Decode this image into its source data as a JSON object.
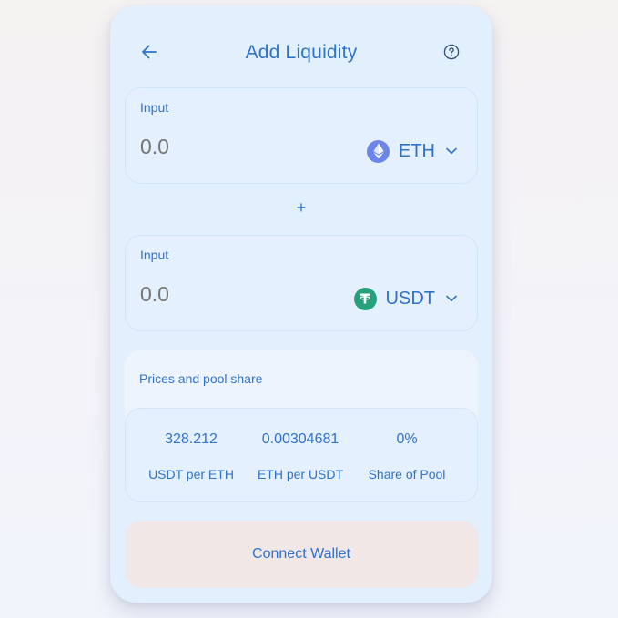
{
  "header": {
    "title": "Add Liquidity",
    "back_icon": "arrow-left-icon",
    "help_icon": "question-circle-icon"
  },
  "input_a": {
    "label": "Input",
    "placeholder": "0.0",
    "token": "ETH",
    "token_icon": "ethereum-icon"
  },
  "plus": "+",
  "input_b": {
    "label": "Input",
    "placeholder": "0.0",
    "token": "USDT",
    "token_icon": "tether-icon"
  },
  "prices": {
    "title": "Prices and pool share",
    "stats": [
      {
        "value": "328.212",
        "label": "USDT per ETH"
      },
      {
        "value": "0.00304681",
        "label": "ETH per USDT"
      },
      {
        "value": "0%",
        "label": "Share of Pool"
      }
    ]
  },
  "connect_button": "Connect Wallet",
  "colors": {
    "accent": "#2f72c9",
    "card": "#e2effd",
    "eth": "#6b86e8",
    "usdt": "#27a17c",
    "connect_bg": "#f1e7e7"
  }
}
